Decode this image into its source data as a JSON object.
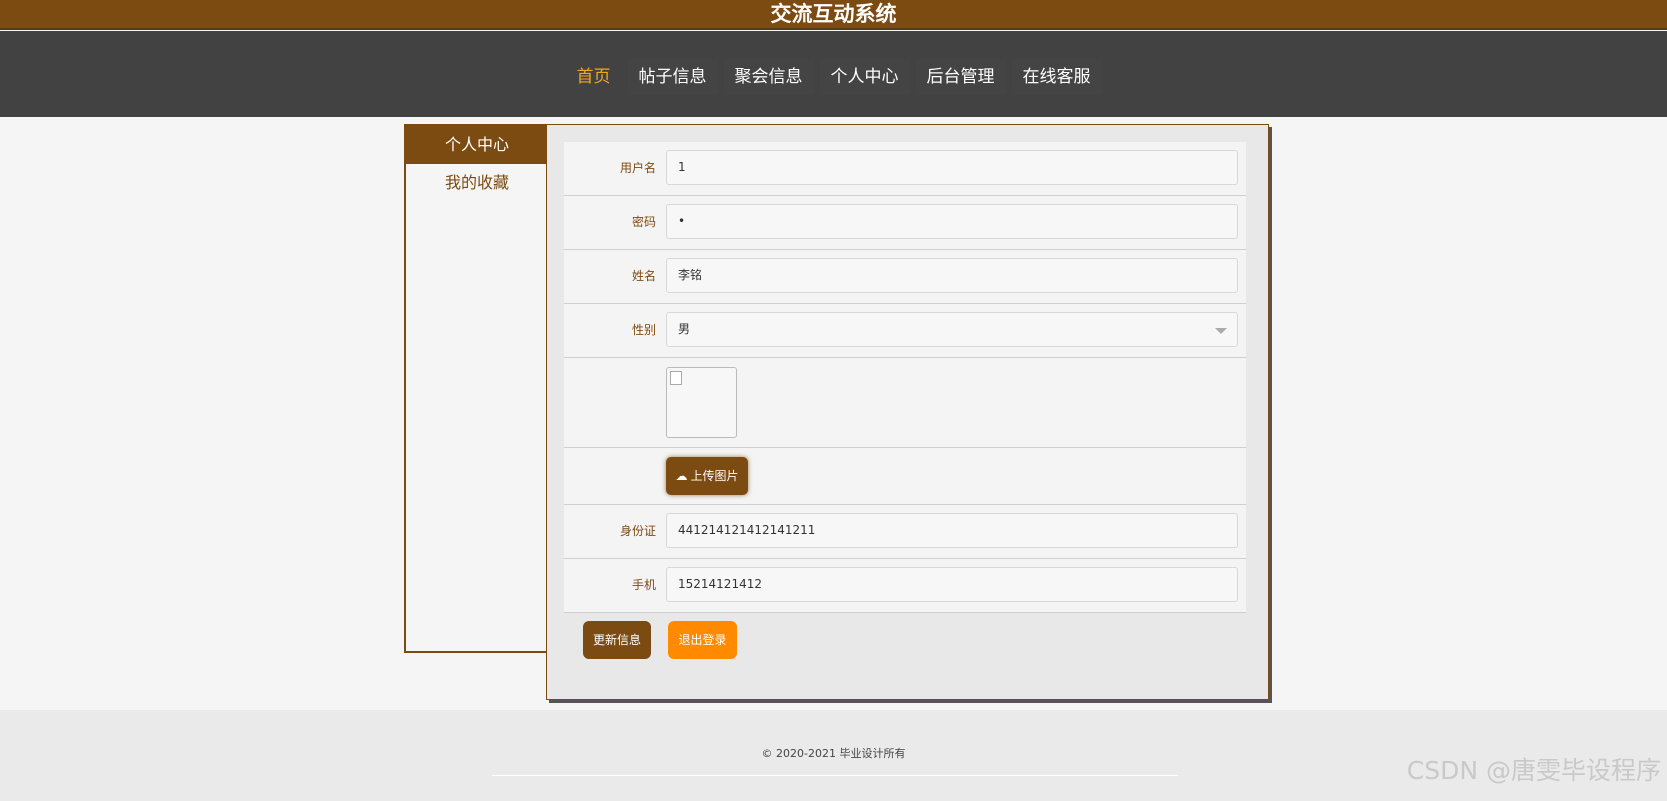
{
  "site": {
    "title": "交流互动系统"
  },
  "nav": {
    "items": [
      {
        "label": "首页"
      },
      {
        "label": "帖子信息"
      },
      {
        "label": "聚会信息"
      },
      {
        "label": "个人中心"
      },
      {
        "label": "后台管理"
      },
      {
        "label": "在线客服"
      }
    ]
  },
  "sidebar": {
    "items": [
      {
        "label": "个人中心"
      },
      {
        "label": "我的收藏"
      }
    ]
  },
  "form": {
    "username": {
      "label": "用户名",
      "value": "1"
    },
    "password": {
      "label": "密码",
      "value": "•"
    },
    "name": {
      "label": "姓名",
      "value": "李铭"
    },
    "gender": {
      "label": "性别",
      "value": "男"
    },
    "upload": {
      "label": "上传图片"
    },
    "id_card": {
      "label": "身份证",
      "value": "441214121412141211"
    },
    "phone": {
      "label": "手机",
      "value": "15214121412"
    }
  },
  "buttons": {
    "update": "更新信息",
    "logout": "退出登录"
  },
  "footer": {
    "copyright": "© 2020-2021 毕业设计所有"
  },
  "watermark": "CSDN @唐雯毕设程序",
  "colors": {
    "brand": "#7b4b12",
    "accent": "#ff8a00",
    "nav_bg": "#424242"
  }
}
